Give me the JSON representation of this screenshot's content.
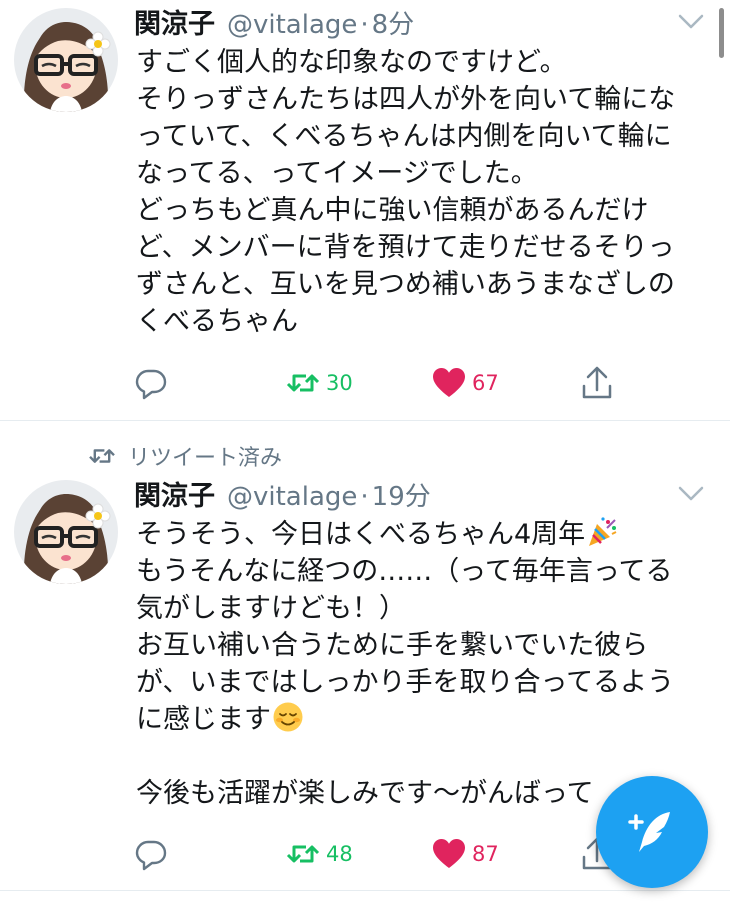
{
  "tweets": [
    {
      "name": "関涼子",
      "handle": "@vitalage",
      "separator": "·",
      "time": "8分",
      "lines": [
        "すごく個人的な印象なのですけど。",
        "そりっずさんたちは四人が外を向いて輪にな",
        "っていて、くべるちゃんは内側を向いて輪に",
        "なってる、ってイメージでした。",
        "どっちもど真ん中に強い信頼があるんだけ",
        "ど、メンバーに背を預けて走りだせるそりっ",
        "ずさんと、互いを見つめ補いあうまなざしの",
        "くべるちゃん"
      ],
      "retweets": "30",
      "likes": "67"
    },
    {
      "retweet_context": "リツイート済み",
      "name": "関涼子",
      "handle": "@vitalage",
      "separator": "·",
      "time": "19分",
      "lines": [
        "そうそう、今日はくべるちゃん4周年",
        "もうそんなに経つの……（って毎年言ってる",
        "気がしますけども！）",
        "お互い補い合うために手を繋いでいた彼ら",
        "が、いまではしっかり手を取り合ってるよう",
        "に感じます",
        "",
        "今後も活躍が楽しみです〜がんばって"
      ],
      "retweets": "48",
      "likes": "87"
    }
  ],
  "icons": {
    "reply": "reply-icon",
    "retweet": "retweet-icon",
    "like": "heart-icon",
    "share": "share-icon",
    "caret": "chevron-down-icon",
    "emoji_party": "party-popper-emoji",
    "emoji_smile": "smiling-face-emoji",
    "compose": "compose-tweet-icon"
  },
  "colors": {
    "accent": "#1da1f2",
    "retweet": "#17bf63",
    "like": "#e0245e",
    "muted": "#657786",
    "text": "#14171a"
  }
}
